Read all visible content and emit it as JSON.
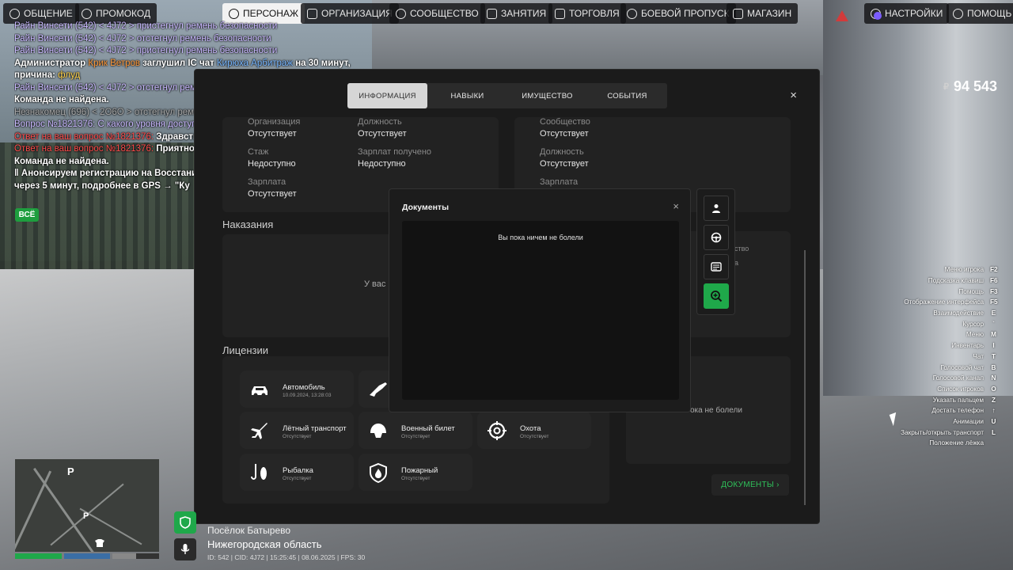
{
  "nav": {
    "left": [
      {
        "label": "ОБЩЕНИЕ",
        "icon": "chat-bubble-icon"
      },
      {
        "label": "ПРОМОКОД",
        "icon": "person-icon"
      }
    ],
    "main": [
      {
        "label": "ПЕРСОНАЖ",
        "icon": "person-circle-icon",
        "active": true
      },
      {
        "label": "ОРГАНИЗАЦИЯ",
        "icon": "organization-icon"
      },
      {
        "label": "СООБЩЕСТВО",
        "icon": "community-icon"
      },
      {
        "label": "ЗАНЯТИЯ",
        "icon": "clipboard-icon"
      },
      {
        "label": "ТОРГОВЛЯ",
        "icon": "chart-icon"
      },
      {
        "label": "БОЕВОЙ ПРОПУСК",
        "icon": "gear-badge-icon"
      },
      {
        "label": "МАГАЗИН",
        "icon": "cart-icon"
      }
    ],
    "right": [
      {
        "label": "НАСТРОЙКИ",
        "icon": "gear-icon"
      },
      {
        "label": "ПОМОЩЬ",
        "icon": "help-chat-icon"
      }
    ]
  },
  "chat": {
    "lines": [
      [
        {
          "t": "Райн Винсети (542) < 4J72 > пристегнул ремень безопасности",
          "c": "purple"
        }
      ],
      [
        {
          "t": "Райн Винсети (542) < 4J72 > отстегнул ремень безопасности",
          "c": "purple"
        }
      ],
      [
        {
          "t": "Райн Винсети (542) < 4J72 > пристегнул ремень безопасности",
          "c": "purple"
        }
      ],
      [
        {
          "t": "Администратор ",
          "c": "white"
        },
        {
          "t": "Крик Ветров",
          "c": "orange"
        },
        {
          "t": " заглушил IC чат ",
          "c": "white"
        },
        {
          "t": "Кирюха Арбитраж",
          "c": "blue"
        },
        {
          "t": " на 30 минут,",
          "c": "white"
        }
      ],
      [
        {
          "t": "причина: ",
          "c": "white"
        },
        {
          "t": "флуд",
          "c": "yellow"
        }
      ],
      [
        {
          "t": "Райн Винсети (542) < 4J72 > отстегнул ремень безопасности",
          "c": "purple"
        }
      ],
      [
        {
          "t": "Команда не найдена.",
          "c": "white"
        }
      ],
      [
        {
          "t": "Незнакомец (696) < 2O6O > отстегнул ремень безопасности",
          "c": "gray"
        }
      ],
      [
        {
          "t": "Вопрос №1821376: С какого уровня доступна работа",
          "c": "purple"
        }
      ],
      [
        {
          "t": "Ответ на ваш вопрос №1821376: ",
          "c": "red"
        },
        {
          "t": "Здравствуйте",
          "c": "white"
        }
      ],
      [
        {
          "t": "Ответ на ваш вопрос №1821376: ",
          "c": "red"
        },
        {
          "t": "Приятной игры",
          "c": "white"
        }
      ],
      [
        {
          "t": "Команда не найдена.",
          "c": "white"
        }
      ],
      [
        {
          "t": "‖ Анонсируем регистрацию на Восстание",
          "c": "white"
        }
      ],
      [
        {
          "t": "через 5 минут, подробнее в GPS → \"Ку",
          "c": "white"
        }
      ]
    ],
    "filter": "ВСЁ"
  },
  "money": {
    "currency": "₽",
    "amount": "94 543"
  },
  "hotkeys": [
    {
      "label": "Меню игрока",
      "key": "F2"
    },
    {
      "label": "Подсказка клавиш",
      "key": "F6"
    },
    {
      "label": "Помощь",
      "key": "F3"
    },
    {
      "label": "Отображение интерфейса",
      "key": "F5"
    },
    {
      "label": "Взаимодействие",
      "key": "E"
    },
    {
      "label": "Курсор",
      "key": "`"
    },
    {
      "label": "Меню",
      "key": "M"
    },
    {
      "label": "Инвентарь",
      "key": "I"
    },
    {
      "label": "Чат",
      "key": "T"
    },
    {
      "label": "Голосовой чат",
      "key": "B"
    },
    {
      "label": "Голосовой канал",
      "key": "N"
    },
    {
      "label": "Список игроков",
      "key": "O"
    },
    {
      "label": "Указать пальцем",
      "key": "Z"
    },
    {
      "label": "Достать телефон",
      "key": "↑"
    },
    {
      "label": "Анимации",
      "key": "U"
    },
    {
      "label": "Закрыть/открыть транспорт",
      "key": "L"
    },
    {
      "label": "Положение лёжка",
      "key": ""
    }
  ],
  "panel": {
    "tabs": [
      "ИНФОРМАЦИЯ",
      "НАВЫКИ",
      "ИМУЩЕСТВО",
      "СОБЫТИЯ"
    ],
    "close": "×",
    "org": {
      "org_label": "Организация",
      "org_value": "Отсутствует",
      "pos_label": "Должность",
      "pos_value": "Отсутствует",
      "exp_label": "Стаж",
      "exp_value": "Недоступно",
      "paid_label": "Зарплат получено",
      "paid_value": "Недоступно",
      "salary_label": "Зарплата",
      "salary_value": "Отсутствует"
    },
    "community": {
      "comm_label": "Сообщество",
      "comm_value": "Отсутствует",
      "pos_label": "Должность",
      "pos_value": "Отсутствует",
      "salary_label": "Зарплата"
    },
    "punishments": {
      "title": "Наказания",
      "empty": "У вас н"
    },
    "right_card": {
      "line1": "ство",
      "line2": "а"
    },
    "licenses_title": "Лицензии",
    "licenses": [
      {
        "name": "Автомобиль",
        "status": "10.09.2024, 13:28:03",
        "icon": "car-icon"
      },
      {
        "name": "",
        "status": "",
        "icon": "rifle-icon"
      },
      {
        "name": "Лётный транспорт",
        "status": "Отсутствует",
        "icon": "plane-icon"
      },
      {
        "name": "Военный билет",
        "status": "Отсутствует",
        "icon": "helmet-icon"
      },
      {
        "name": "Охота",
        "status": "Отсутствует",
        "icon": "crosshair-icon"
      },
      {
        "name": "Рыбалка",
        "status": "Отсутствует",
        "icon": "fish-hook-icon"
      },
      {
        "name": "Пожарный",
        "status": "Отсутствует",
        "icon": "fire-shield-icon"
      }
    ],
    "medical_empty": "ока не болели",
    "documents_button": "ДОКУМЕНТЫ ›"
  },
  "modal": {
    "title": "Документы",
    "close": "×",
    "empty": "Вы пока ничем не болели"
  },
  "side_buttons": [
    {
      "icon": "person-icon",
      "active": false
    },
    {
      "icon": "steering-wheel-icon",
      "active": false
    },
    {
      "icon": "id-card-icon",
      "active": false
    },
    {
      "icon": "medical-search-icon",
      "active": true
    }
  ],
  "location": {
    "name": "Посёлок Батырево",
    "region": "Нижегородская область",
    "info": "ID: 542 | CID: 4J72 | 15:25:45  | 08.06.2025 | FPS: 30"
  },
  "status_bars": [
    {
      "name": "health",
      "fraction": 1.0,
      "color": "#1fa84a"
    },
    {
      "name": "armor",
      "fraction": 1.0,
      "color": "#3a6ea5"
    },
    {
      "name": "hunger",
      "fraction": 0.5,
      "color": "#888888"
    }
  ],
  "minimap": {
    "marker": "P"
  }
}
